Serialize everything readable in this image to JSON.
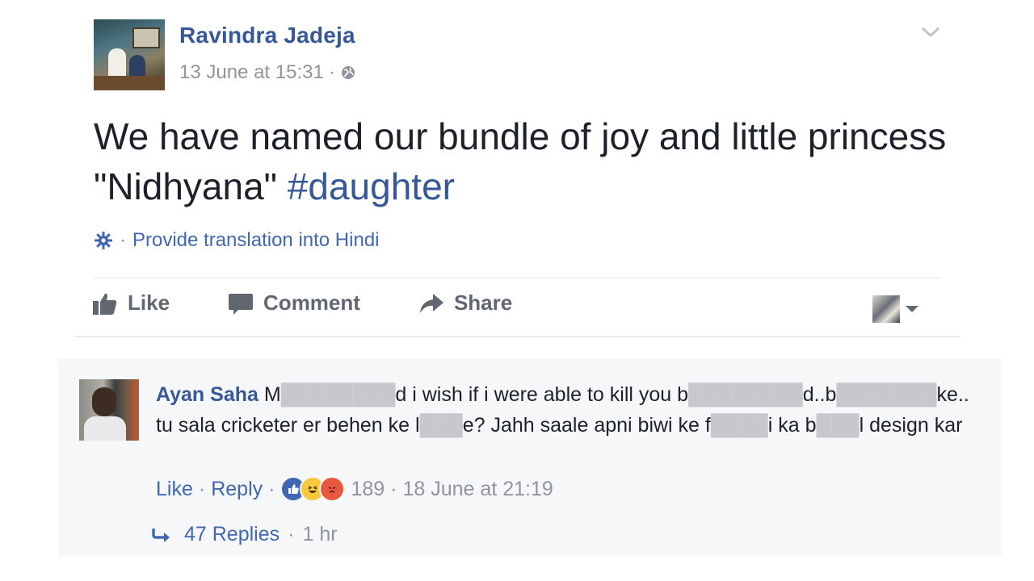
{
  "post": {
    "author": "Ravindra Jadeja",
    "timestamp": "13 June at 15:31",
    "separator": "·",
    "privacy_icon": "globe-icon",
    "text_main": "We have named our bundle of joy and little princess \"Nidhyana\"",
    "hashtag": "#daughter",
    "translate_link": "Provide translation into Hindi"
  },
  "actions": {
    "like": "Like",
    "comment": "Comment",
    "share": "Share"
  },
  "comment": {
    "author": "Ayan Saha",
    "segments": [
      "M",
      "████████",
      "d i wish if i were able to kill you b",
      "████████",
      "d..b",
      "███████",
      "ke.. tu sala cricketer er behen ke l",
      "███",
      "e? Jahh saale apni biwi ke f",
      "████",
      "i ka b",
      "███",
      "l design kar"
    ],
    "like": "Like",
    "reply": "Reply",
    "reaction_count": "189",
    "date": "18 June at 21:19",
    "reactions": [
      "like-reaction-icon",
      "haha-reaction-icon",
      "angry-reaction-icon"
    ]
  },
  "replies": {
    "label": "47 Replies",
    "time": "1 hr"
  },
  "colors": {
    "link_blue": "#365899",
    "meta_gray": "#90949c",
    "comment_bg": "#f6f7f9"
  }
}
